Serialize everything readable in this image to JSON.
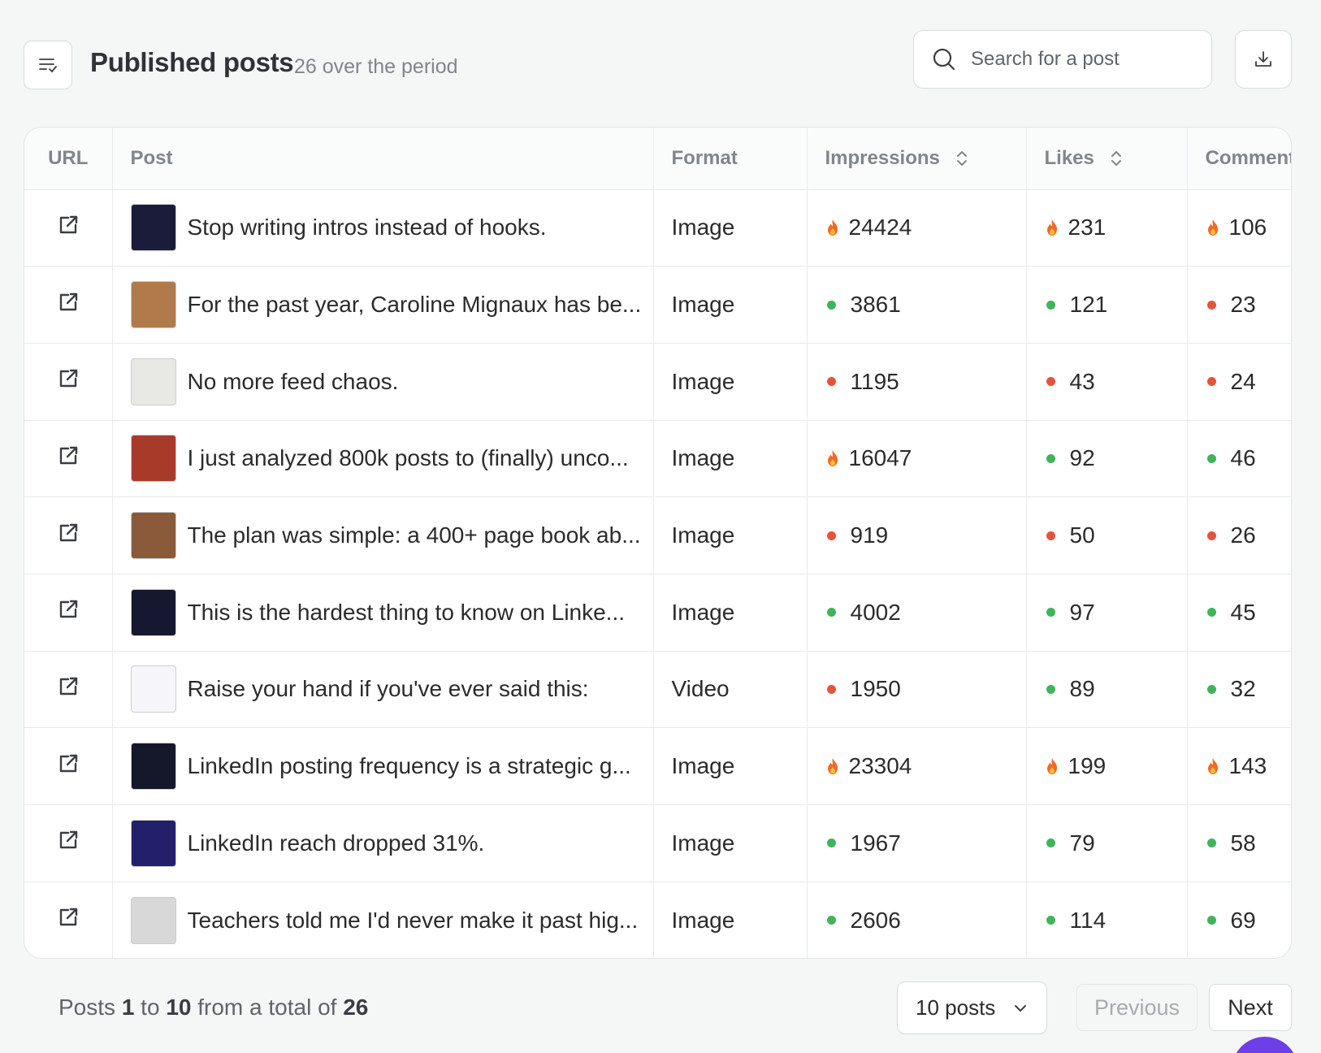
{
  "header": {
    "title": "Published posts",
    "subtitle": "26 over the period",
    "search_placeholder": "Search for a post"
  },
  "columns": {
    "url": "URL",
    "post": "Post",
    "format": "Format",
    "impressions": "Impressions",
    "likes": "Likes",
    "comments": "Comment"
  },
  "colors": {
    "green": "#3fb45a",
    "red": "#e5533d",
    "fire": "#f06a24",
    "accent": "#6d3fe8"
  },
  "rows": [
    {
      "text": "Stop writing intros instead of hooks.",
      "format": "Image",
      "impressions": {
        "value": "24424",
        "status": "fire"
      },
      "likes": {
        "value": "231",
        "status": "fire"
      },
      "comments": {
        "value": "106",
        "status": "fire"
      },
      "thumb": "#1b1b3a"
    },
    {
      "text": "For the past year, Caroline Mignaux has be...",
      "format": "Image",
      "impressions": {
        "value": "3861",
        "status": "green"
      },
      "likes": {
        "value": "121",
        "status": "green"
      },
      "comments": {
        "value": "23",
        "status": "red"
      },
      "thumb": "#b07a4a"
    },
    {
      "text": "No more feed chaos.",
      "format": "Image",
      "impressions": {
        "value": "1195",
        "status": "red"
      },
      "likes": {
        "value": "43",
        "status": "red"
      },
      "comments": {
        "value": "24",
        "status": "red"
      },
      "thumb": "#e8e8e4"
    },
    {
      "text": "I just analyzed 800k posts to (finally) unco...",
      "format": "Image",
      "impressions": {
        "value": "16047",
        "status": "fire"
      },
      "likes": {
        "value": "92",
        "status": "green"
      },
      "comments": {
        "value": "46",
        "status": "green"
      },
      "thumb": "#a83a2a"
    },
    {
      "text": "The plan was simple: a 400+ page book ab...",
      "format": "Image",
      "impressions": {
        "value": "919",
        "status": "red"
      },
      "likes": {
        "value": "50",
        "status": "red"
      },
      "comments": {
        "value": "26",
        "status": "red"
      },
      "thumb": "#8a5a3a"
    },
    {
      "text": "This is the hardest thing to know on Linke...",
      "format": "Image",
      "impressions": {
        "value": "4002",
        "status": "green"
      },
      "likes": {
        "value": "97",
        "status": "green"
      },
      "comments": {
        "value": "45",
        "status": "green"
      },
      "thumb": "#151830"
    },
    {
      "text": "Raise your hand if you've ever said this:",
      "format": "Video",
      "impressions": {
        "value": "1950",
        "status": "red"
      },
      "likes": {
        "value": "89",
        "status": "green"
      },
      "comments": {
        "value": "32",
        "status": "green"
      },
      "thumb": "#f6f6fa"
    },
    {
      "text": "LinkedIn posting frequency is a strategic g...",
      "format": "Image",
      "impressions": {
        "value": "23304",
        "status": "fire"
      },
      "likes": {
        "value": "199",
        "status": "fire"
      },
      "comments": {
        "value": "143",
        "status": "fire"
      },
      "thumb": "#15182a"
    },
    {
      "text": "LinkedIn reach dropped 31%.",
      "format": "Image",
      "impressions": {
        "value": "1967",
        "status": "green"
      },
      "likes": {
        "value": "79",
        "status": "green"
      },
      "comments": {
        "value": "58",
        "status": "green"
      },
      "thumb": "#22206a"
    },
    {
      "text": "Teachers told me I'd never make it past hig...",
      "format": "Image",
      "impressions": {
        "value": "2606",
        "status": "green"
      },
      "likes": {
        "value": "114",
        "status": "green"
      },
      "comments": {
        "value": "69",
        "status": "green"
      },
      "thumb": "#d8d8d8"
    }
  ],
  "footer": {
    "prefix": "Posts ",
    "from": "1",
    "to_word": " to ",
    "to": "10",
    "total_word": " from a total of ",
    "total": "26",
    "per_page": "10 posts",
    "previous": "Previous",
    "next": "Next"
  }
}
